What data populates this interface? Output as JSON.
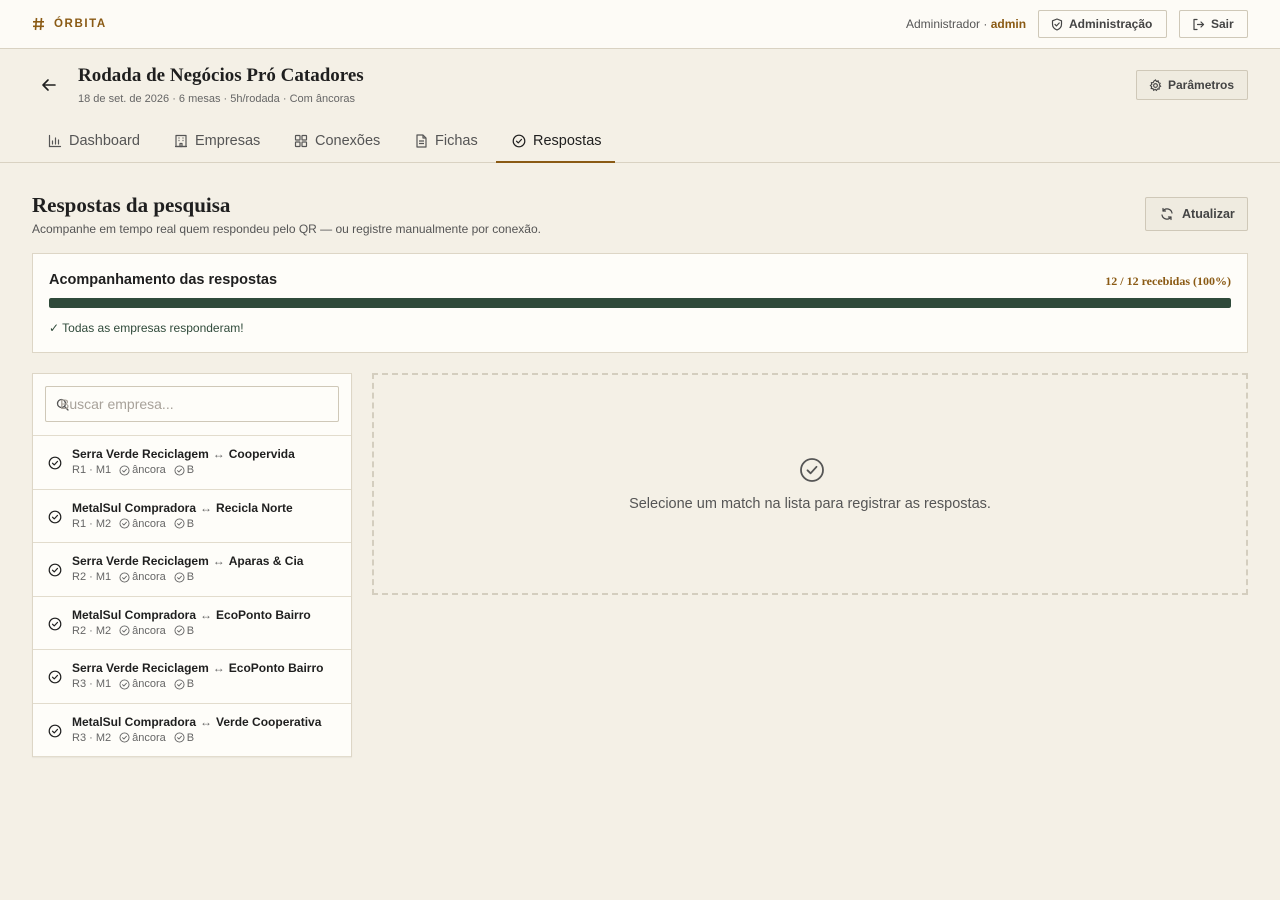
{
  "app": {
    "brand": "ÓRBITA"
  },
  "topbar": {
    "role": "Administrador",
    "sep": "·",
    "username": "admin",
    "admin_label": "Administração",
    "logout_label": "Sair"
  },
  "event": {
    "title": "Rodada de Negócios Pró Catadores",
    "meta": "18 de set. de 2026 · 6 mesas · 5h/rodada · Com âncoras",
    "params_label": "Parâmetros"
  },
  "tabs": [
    {
      "label": "Dashboard",
      "icon": "bar-chart-icon"
    },
    {
      "label": "Empresas",
      "icon": "building-icon"
    },
    {
      "label": "Conexões",
      "icon": "grid-icon"
    },
    {
      "label": "Fichas",
      "icon": "document-icon"
    },
    {
      "label": "Respostas",
      "icon": "check-circle-icon",
      "active": true
    }
  ],
  "page": {
    "title": "Respostas da pesquisa",
    "subtitle": "Acompanhe em tempo real quem respondeu pelo QR — ou registre manualmente por conexão.",
    "refresh_label": "Atualizar"
  },
  "progress": {
    "title": "Acompanhamento das respostas",
    "count_text": "12 / 12 recebidas (100%)",
    "fraction": 1.0,
    "done_text": "✓ Todas as empresas responderam!"
  },
  "search": {
    "placeholder": "Buscar empresa...",
    "value": ""
  },
  "matches": [
    {
      "a": "Serra Verde Reciclagem",
      "b": "Coopervida",
      "round": "R1 · M1",
      "anchor": "âncora",
      "tag": "B"
    },
    {
      "a": "MetalSul Compradora",
      "b": "Recicla Norte",
      "round": "R1 · M2",
      "anchor": "âncora",
      "tag": "B"
    },
    {
      "a": "Serra Verde Reciclagem",
      "b": "Aparas & Cia",
      "round": "R2 · M1",
      "anchor": "âncora",
      "tag": "B"
    },
    {
      "a": "MetalSul Compradora",
      "b": "EcoPonto Bairro",
      "round": "R2 · M2",
      "anchor": "âncora",
      "tag": "B"
    },
    {
      "a": "Serra Verde Reciclagem",
      "b": "EcoPonto Bairro",
      "round": "R3 · M1",
      "anchor": "âncora",
      "tag": "B"
    },
    {
      "a": "MetalSul Compradora",
      "b": "Verde Cooperativa",
      "round": "R3 · M2",
      "anchor": "âncora",
      "tag": "B"
    }
  ],
  "match_arrow": "↔",
  "empty_state": {
    "text": "Selecione um match na lista para registrar as respostas."
  },
  "colors": {
    "accent": "#8a5a14",
    "progress_fill": "#2f4a3a",
    "background": "#f4f0e6"
  }
}
